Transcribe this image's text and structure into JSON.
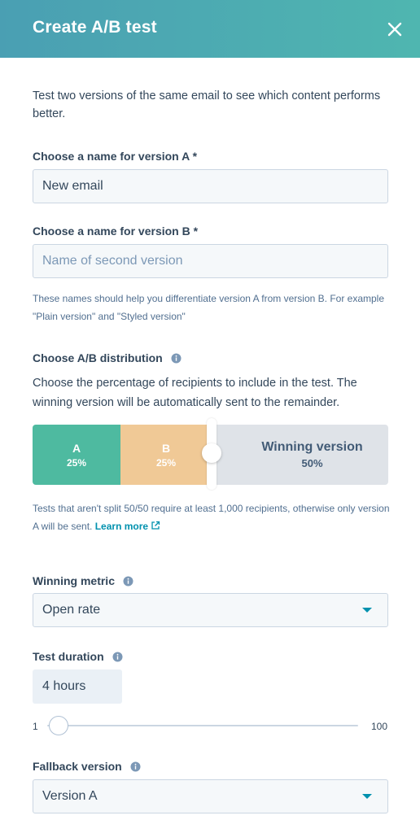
{
  "header": {
    "title": "Create A/B test",
    "close_icon": "close-icon"
  },
  "intro": "Test two versions of the same email to see which content performs better.",
  "version_a": {
    "label": "Choose a name for version A *",
    "value": "New email",
    "placeholder": ""
  },
  "version_b": {
    "label": "Choose a name for version B *",
    "value": "",
    "placeholder": "Name of second version"
  },
  "names_help": "These names should help you differentiate version A from version B. For example \"Plain version\" and \"Styled version\"",
  "distribution": {
    "label": "Choose A/B distribution",
    "description": "Choose the percentage of recipients to include in the test. The winning version will be automatically sent to the remainder.",
    "segments": [
      {
        "name": "A",
        "percent": "25%",
        "value": 25,
        "color": "#4ebaa0"
      },
      {
        "name": "B",
        "percent": "25%",
        "value": 25,
        "color": "#f0c996"
      },
      {
        "name": "Winning version",
        "percent": "50%",
        "value": 50,
        "color": "#dfe3e8"
      }
    ],
    "help": "Tests that aren't split 50/50 require at least 1,000 recipients, otherwise only version A will be sent.",
    "learn_more": "Learn more"
  },
  "winning_metric": {
    "label": "Winning metric",
    "value": "Open rate"
  },
  "test_duration": {
    "label": "Test duration",
    "value": "4 hours",
    "min": "1",
    "max": "100",
    "slider_value": 4
  },
  "fallback": {
    "label": "Fallback version",
    "value": "Version A"
  },
  "colors": {
    "accent": "#0091ae",
    "header_start": "#4a9fb3",
    "header_end": "#4fb6b0",
    "text": "#33475b"
  }
}
